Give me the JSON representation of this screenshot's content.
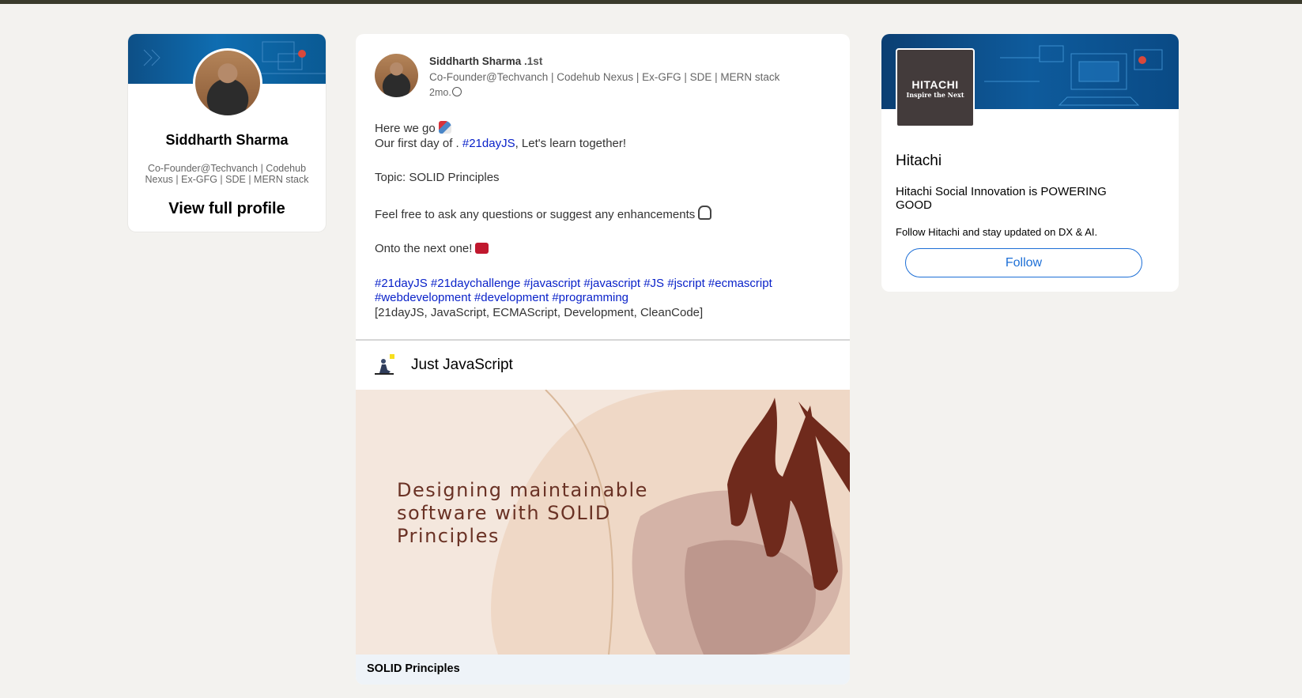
{
  "profile": {
    "name": "Siddharth Sharma",
    "headline": "Co-Founder@Techvanch | Codehub Nexus | Ex-GFG | SDE | MERN stack",
    "link_label": "View full profile"
  },
  "post": {
    "author_name": "Siddharth Sharma",
    "author_degree": ".1st",
    "author_headline": "Co-Founder@Techvanch | Codehub Nexus | Ex-GFG | SDE | MERN stack",
    "time": "2mo.",
    "line1": "Here we go",
    "line2_prefix": "Our first day of .",
    "line2_hashtag": "#21dayJS",
    "line2_suffix": ", Let's learn together!",
    "topic": "Topic: SOLID Principles",
    "ask": "Feel free to ask any questions or suggest any enhancements",
    "next": "Onto the next one!",
    "hashtags_line1": "#21dayJS #21daychallenge #javascript #javascript #JS #jscript #ecmascript",
    "hashtags_line2": "#webdevelopment #development #programming",
    "tags": "[21dayJS, JavaScript, ECMAScript, Development, CleanCode]",
    "article": {
      "source": "Just JavaScript",
      "image_text": "Designing maintainable\nsoftware with SOLID\nPrinciples",
      "caption": "SOLID Principles"
    }
  },
  "ad": {
    "logo_main": "HITACHI",
    "logo_sub": "Inspire the Next",
    "company": "Hitachi",
    "tagline": "Hitachi Social Innovation is POWERING GOOD",
    "description": "Follow Hitachi and stay updated on DX & AI.",
    "follow_label": "Follow"
  },
  "colors": {
    "background": "#f3f2ef",
    "hashtag": "#0a22c9",
    "follow": "#1d6fd6",
    "image_text": "#6a3225"
  }
}
